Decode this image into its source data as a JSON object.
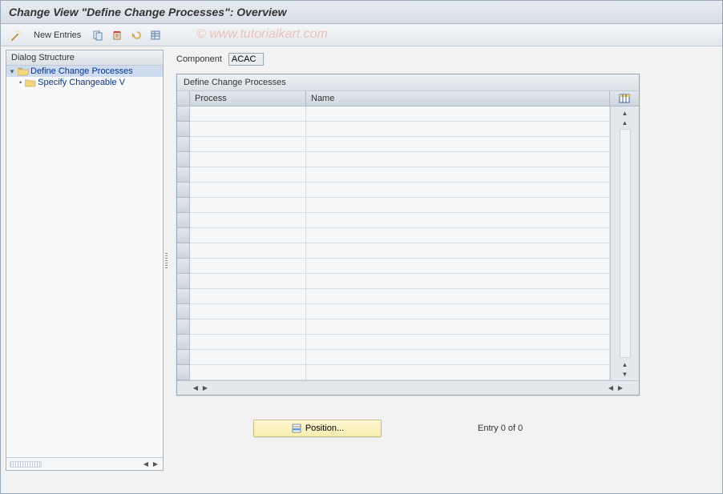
{
  "header": {
    "title": "Change View \"Define Change Processes\": Overview",
    "watermark": "© www.tutorialkart.com"
  },
  "toolbar": {
    "new_entries_label": "New Entries"
  },
  "tree": {
    "header": "Dialog Structure",
    "nodes": {
      "root": {
        "label": "Define Change Processes"
      },
      "child": {
        "label": "Specify Changeable V"
      }
    }
  },
  "main": {
    "component_label": "Component",
    "component_value": "ACAC",
    "grid": {
      "title": "Define Change Processes",
      "columns": {
        "process": "Process",
        "name": "Name"
      }
    },
    "footer": {
      "position_label": "Position...",
      "entry_label": "Entry 0 of 0"
    }
  }
}
